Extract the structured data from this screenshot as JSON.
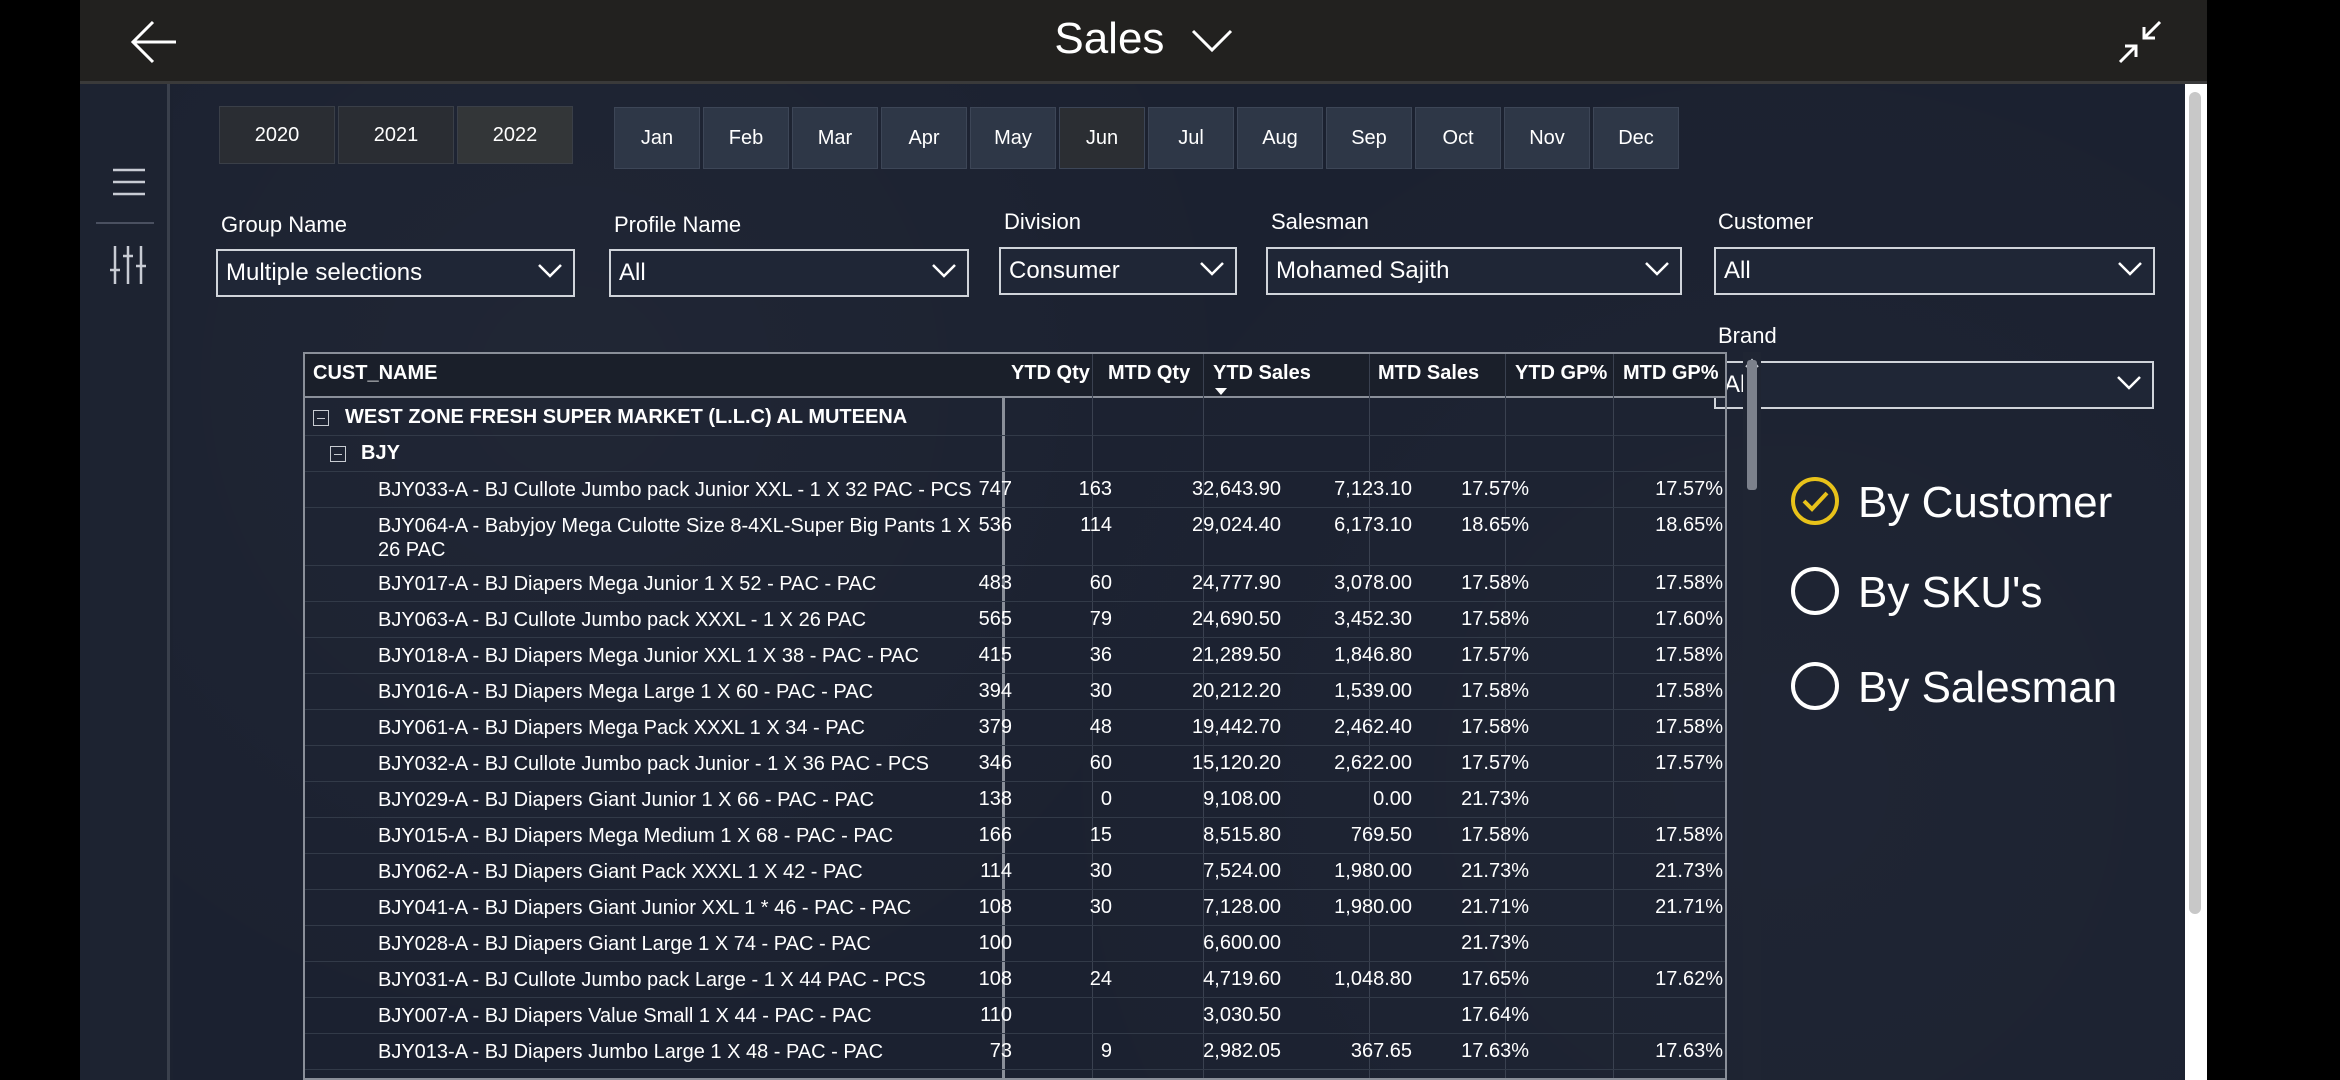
{
  "header": {
    "title": "Sales"
  },
  "years": [
    {
      "label": "2020",
      "selected": false
    },
    {
      "label": "2021",
      "selected": false
    },
    {
      "label": "2022",
      "selected": true
    }
  ],
  "months": [
    {
      "label": "Jan",
      "selected": false
    },
    {
      "label": "Feb",
      "selected": false
    },
    {
      "label": "Mar",
      "selected": false
    },
    {
      "label": "Apr",
      "selected": false
    },
    {
      "label": "May",
      "selected": false
    },
    {
      "label": "Jun",
      "selected": true
    },
    {
      "label": "Jul",
      "selected": false
    },
    {
      "label": "Aug",
      "selected": false
    },
    {
      "label": "Sep",
      "selected": false
    },
    {
      "label": "Oct",
      "selected": false
    },
    {
      "label": "Nov",
      "selected": false
    },
    {
      "label": "Dec",
      "selected": false
    }
  ],
  "filters": {
    "group_name": {
      "label": "Group Name",
      "value": "Multiple selections"
    },
    "profile_name": {
      "label": "Profile Name",
      "value": "All"
    },
    "division": {
      "label": "Division",
      "value": "Consumer"
    },
    "salesman": {
      "label": "Salesman",
      "value": "Mohamed Sajith"
    },
    "customer": {
      "label": "Customer",
      "value": "All"
    },
    "brand": {
      "label": "Brand",
      "value": "All"
    }
  },
  "table": {
    "headers": {
      "cust_name": "CUST_NAME",
      "ytd_qty": "YTD Qty",
      "mtd_qty": "MTD Qty",
      "ytd_sales": "YTD Sales",
      "mtd_sales": "MTD Sales",
      "ytd_gp": "YTD GP%",
      "mtd_gp": "MTD GP%"
    },
    "sort_column": "YTD Sales",
    "group": "WEST ZONE FRESH SUPER MARKET (L.L.C) AL MUTEENA",
    "subgroup": "BJY",
    "rows": [
      {
        "name": "BJY033-A - BJ Cullote Jumbo pack Junior XXL - 1 X 32 PAC - PCS",
        "ytd_qty": "747",
        "mtd_qty": "163",
        "ytd_sales": "32,643.90",
        "mtd_sales": "7,123.10",
        "ytd_gp": "17.57%",
        "mtd_gp": "17.57%"
      },
      {
        "name": "BJY064-A - Babyjoy Mega Culotte Size 8-4XL-Super Big Pants 1 X 26 PAC",
        "ytd_qty": "536",
        "mtd_qty": "114",
        "ytd_sales": "29,024.40",
        "mtd_sales": "6,173.10",
        "ytd_gp": "18.65%",
        "mtd_gp": "18.65%"
      },
      {
        "name": "BJY017-A - BJ Diapers Mega Junior 1 X 52 - PAC - PAC",
        "ytd_qty": "483",
        "mtd_qty": "60",
        "ytd_sales": "24,777.90",
        "mtd_sales": "3,078.00",
        "ytd_gp": "17.58%",
        "mtd_gp": "17.58%"
      },
      {
        "name": "BJY063-A - BJ Cullote Jumbo pack XXXL - 1 X 26 PAC",
        "ytd_qty": "565",
        "mtd_qty": "79",
        "ytd_sales": "24,690.50",
        "mtd_sales": "3,452.30",
        "ytd_gp": "17.58%",
        "mtd_gp": "17.60%"
      },
      {
        "name": "BJY018-A - BJ Diapers Mega Junior XXL 1 X 38 - PAC - PAC",
        "ytd_qty": "415",
        "mtd_qty": "36",
        "ytd_sales": "21,289.50",
        "mtd_sales": "1,846.80",
        "ytd_gp": "17.57%",
        "mtd_gp": "17.58%"
      },
      {
        "name": "BJY016-A - BJ Diapers Mega Large 1 X 60 - PAC - PAC",
        "ytd_qty": "394",
        "mtd_qty": "30",
        "ytd_sales": "20,212.20",
        "mtd_sales": "1,539.00",
        "ytd_gp": "17.58%",
        "mtd_gp": "17.58%"
      },
      {
        "name": "BJY061-A - BJ Diapers Mega Pack XXXL 1 X 34 - PAC",
        "ytd_qty": "379",
        "mtd_qty": "48",
        "ytd_sales": "19,442.70",
        "mtd_sales": "2,462.40",
        "ytd_gp": "17.58%",
        "mtd_gp": "17.58%"
      },
      {
        "name": "BJY032-A - BJ Cullote Jumbo pack Junior - 1 X 36 PAC - PCS",
        "ytd_qty": "346",
        "mtd_qty": "60",
        "ytd_sales": "15,120.20",
        "mtd_sales": "2,622.00",
        "ytd_gp": "17.57%",
        "mtd_gp": "17.57%"
      },
      {
        "name": "BJY029-A - BJ Diapers Giant Junior 1 X 66 - PAC - PAC",
        "ytd_qty": "138",
        "mtd_qty": "0",
        "ytd_sales": "9,108.00",
        "mtd_sales": "0.00",
        "ytd_gp": "21.73%",
        "mtd_gp": ""
      },
      {
        "name": "BJY015-A - BJ Diapers Mega Medium 1 X 68 - PAC - PAC",
        "ytd_qty": "166",
        "mtd_qty": "15",
        "ytd_sales": "8,515.80",
        "mtd_sales": "769.50",
        "ytd_gp": "17.58%",
        "mtd_gp": "17.58%"
      },
      {
        "name": "BJY062-A - BJ Diapers Giant Pack XXXL 1 X 42 - PAC",
        "ytd_qty": "114",
        "mtd_qty": "30",
        "ytd_sales": "7,524.00",
        "mtd_sales": "1,980.00",
        "ytd_gp": "21.73%",
        "mtd_gp": "21.73%"
      },
      {
        "name": "BJY041-A - BJ Diapers Giant Junior XXL 1 * 46 - PAC - PAC",
        "ytd_qty": "108",
        "mtd_qty": "30",
        "ytd_sales": "7,128.00",
        "mtd_sales": "1,980.00",
        "ytd_gp": "21.71%",
        "mtd_gp": "21.71%"
      },
      {
        "name": "BJY028-A - BJ Diapers Giant Large 1 X 74 - PAC - PAC",
        "ytd_qty": "100",
        "mtd_qty": "",
        "ytd_sales": "6,600.00",
        "mtd_sales": "",
        "ytd_gp": "21.73%",
        "mtd_gp": ""
      },
      {
        "name": "BJY031-A - BJ Cullote Jumbo pack Large - 1 X 44 PAC - PCS",
        "ytd_qty": "108",
        "mtd_qty": "24",
        "ytd_sales": "4,719.60",
        "mtd_sales": "1,048.80",
        "ytd_gp": "17.65%",
        "mtd_gp": "17.62%"
      },
      {
        "name": "BJY007-A - BJ Diapers Value Small 1 X 44 - PAC - PAC",
        "ytd_qty": "110",
        "mtd_qty": "",
        "ytd_sales": "3,030.50",
        "mtd_sales": "",
        "ytd_gp": "17.64%",
        "mtd_gp": ""
      },
      {
        "name": "BJY013-A - BJ Diapers Jumbo Large 1 X 48 - PAC - PAC",
        "ytd_qty": "73",
        "mtd_qty": "9",
        "ytd_sales": "2,982.05",
        "mtd_sales": "367.65",
        "ytd_gp": "17.63%",
        "mtd_gp": "17.63%"
      }
    ]
  },
  "view_options": [
    {
      "label": "By Customer",
      "selected": true
    },
    {
      "label": "By SKU's",
      "selected": false
    },
    {
      "label": "By Salesman",
      "selected": false
    }
  ],
  "colors": {
    "accent": "#e8c21a",
    "background": "#1c2230",
    "topbar": "#22211f"
  }
}
